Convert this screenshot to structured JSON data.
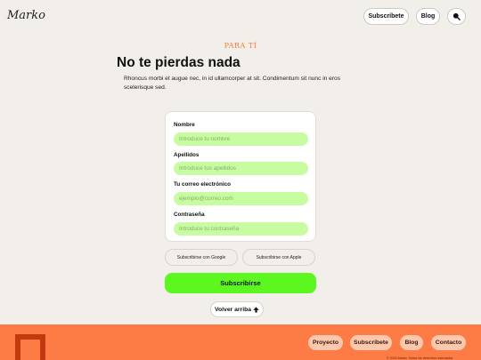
{
  "header": {
    "logo": "Marko",
    "subscribe_label": "Subscríbete",
    "blog_label": "Blog",
    "search_icon": "search-icon"
  },
  "hero": {
    "eyebrow": "PARA TÍ",
    "title": "No te pierdas nada",
    "description": "Rhoncus morbi et augue nec, in id ullamcorper at sit. Condimentum sit nunc in eros scelerisque sed."
  },
  "form": {
    "fields": [
      {
        "label": "Nombre",
        "placeholder": "Introduce tu nombre"
      },
      {
        "label": "Apellidos",
        "placeholder": "Introduce tus apellidos"
      },
      {
        "label": "Tu correo electrónico",
        "placeholder": "ejemplo@correo.com"
      },
      {
        "label": "Contraseña",
        "placeholder": "Introduce tu contraseña"
      }
    ],
    "google_label": "Subscribirse con Google",
    "apple_label": "Subscribirse con Apple",
    "submit_label": "Subscribirse"
  },
  "back_to_top": {
    "label": "Volver arriba",
    "icon": "arrow-up-icon"
  },
  "footer": {
    "links": [
      "Proyecto",
      "Subscríbete",
      "Blog",
      "Contacto"
    ],
    "copyright": "© 2024 Marko. Todos los derechos reservados"
  },
  "colors": {
    "background": "#f2eee9",
    "accent_orange": "#fd7b45",
    "input_green": "#c8fca0",
    "button_green": "#5cf71e"
  }
}
